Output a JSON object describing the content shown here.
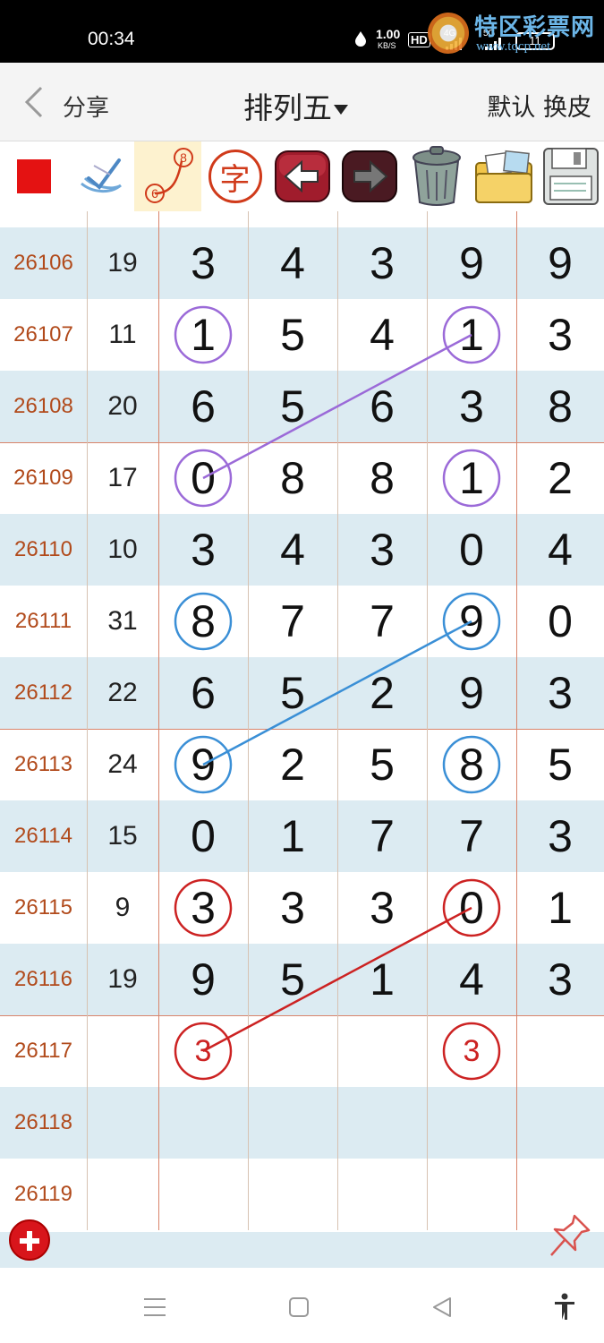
{
  "status": {
    "time": "00:34",
    "net_speed": "1.00",
    "net_unit": "KB/S",
    "hd": "HD",
    "sig4g": "4G",
    "sig5g": "5G",
    "battery": "11"
  },
  "watermark": {
    "name": "特区彩票网",
    "url": "www.tqcp.net"
  },
  "titlebar": {
    "share": "分享",
    "title": "排列五",
    "right": "默认 换皮"
  },
  "toolbar": {
    "icons": [
      "red-square",
      "check-pen",
      "link-68",
      "zi-stamp",
      "back-arrow",
      "forward-arrow",
      "trash-bin",
      "picture-folder",
      "save-disk"
    ],
    "zi_char": "字",
    "link_top": "8",
    "link_bottom": "6"
  },
  "rows": [
    {
      "id": "26106",
      "sum": "19",
      "n": [
        "3",
        "4",
        "3",
        "9",
        "9"
      ]
    },
    {
      "id": "26107",
      "sum": "11",
      "n": [
        "1",
        "5",
        "4",
        "1",
        "3"
      ]
    },
    {
      "id": "26108",
      "sum": "20",
      "n": [
        "6",
        "5",
        "6",
        "3",
        "8"
      ]
    },
    {
      "id": "26109",
      "sum": "17",
      "n": [
        "0",
        "8",
        "8",
        "1",
        "2"
      ]
    },
    {
      "id": "26110",
      "sum": "10",
      "n": [
        "3",
        "4",
        "3",
        "0",
        "4"
      ]
    },
    {
      "id": "26111",
      "sum": "31",
      "n": [
        "8",
        "7",
        "7",
        "9",
        "0"
      ]
    },
    {
      "id": "26112",
      "sum": "22",
      "n": [
        "6",
        "5",
        "2",
        "9",
        "3"
      ]
    },
    {
      "id": "26113",
      "sum": "24",
      "n": [
        "9",
        "2",
        "5",
        "8",
        "5"
      ]
    },
    {
      "id": "26114",
      "sum": "15",
      "n": [
        "0",
        "1",
        "7",
        "7",
        "3"
      ]
    },
    {
      "id": "26115",
      "sum": "9",
      "n": [
        "3",
        "3",
        "3",
        "0",
        "1"
      ]
    },
    {
      "id": "26116",
      "sum": "19",
      "n": [
        "9",
        "5",
        "1",
        "4",
        "3"
      ]
    },
    {
      "id": "26117",
      "sum": "",
      "n": [
        "3",
        "",
        "",
        "3",
        ""
      ]
    },
    {
      "id": "26118",
      "sum": "",
      "n": [
        "",
        "",
        "",
        "",
        ""
      ]
    },
    {
      "id": "26119",
      "sum": "",
      "n": [
        "",
        "",
        "",
        "",
        ""
      ]
    }
  ],
  "colors": {
    "purple": "#9b6ad8",
    "blue": "#3a8fd6",
    "red": "#cc2222",
    "id_text": "#b14a1b",
    "alt_row": "#dcebf2"
  },
  "navbar": {
    "icons": [
      "menu-icon",
      "home-icon",
      "back-icon",
      "accessibility-icon"
    ]
  }
}
